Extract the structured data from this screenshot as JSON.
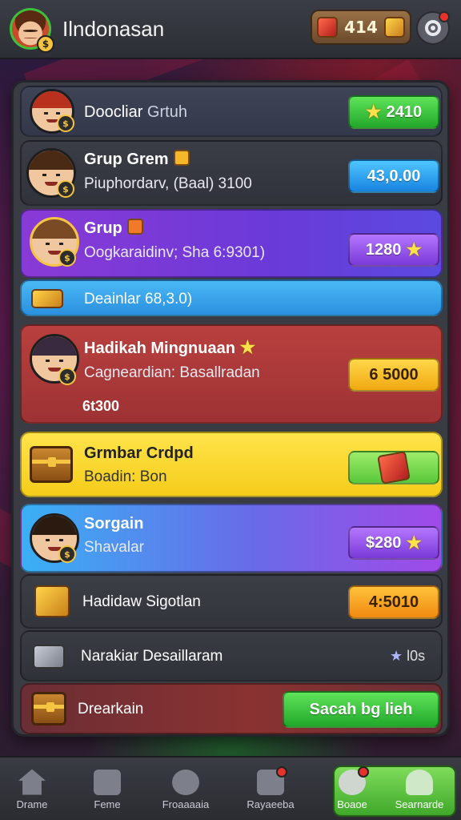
{
  "header": {
    "title": "Ilndonasan",
    "currency_value": "414",
    "gem_icon": "gem-icon",
    "chest_icon": "chest-icon",
    "settings_icon": "settings-icon"
  },
  "items": [
    {
      "title": "Doocliar",
      "subtitle": "Grtuh",
      "button": "2410",
      "button_color": "#3fc83a"
    },
    {
      "title": "Grup Grem",
      "subtitle": "Piuphordarv, (Baal) 3100",
      "button": "43,0.00",
      "button_color": "#2a9aef"
    },
    {
      "title": "Grup",
      "subtitle": "Oogkaraidinv; Sha 6:9301)",
      "button": "1280",
      "button_color": "#9a5aef"
    },
    {
      "title": "",
      "subtitle": "Deainlar 68,3.0)",
      "button": "",
      "button_color": "#3aa8f0"
    },
    {
      "title": "Hadikah Mingnuaan",
      "subtitle": "Cagneardian: Basallradan",
      "extra": "6t300",
      "button": "6 5000",
      "button_color": "#f5c02a"
    },
    {
      "title": "Grmbar Crdpd",
      "subtitle": "Boadin: Bon",
      "button": "",
      "button_color": "#7ad84a"
    },
    {
      "title": "Sorgain",
      "subtitle": "Shavalar",
      "button": "$280",
      "button_color": "#9a5aef"
    },
    {
      "title": "Hadidaw Sigotlan",
      "subtitle": "",
      "button": "4:5010",
      "button_color": "#f5a020"
    },
    {
      "title": "Narakiar Desaillaram",
      "subtitle": "",
      "button": "l0s",
      "button_color": ""
    },
    {
      "title": "Drearkain",
      "subtitle": "",
      "button": "Sacah bg lieh",
      "button_color": "#28c840"
    }
  ],
  "nav": [
    {
      "label": "Drame",
      "icon": "home-icon"
    },
    {
      "label": "Feme",
      "icon": "shop-icon"
    },
    {
      "label": "Froaaaaia",
      "icon": "search-icon"
    },
    {
      "label": "Rayaeeba",
      "icon": "rewards-icon"
    },
    {
      "label": "Boaoe",
      "icon": "badge-icon"
    },
    {
      "label": "Searnarde",
      "icon": "profile-icon"
    }
  ],
  "colors": {
    "accent_green": "#3fc83a",
    "accent_blue": "#2a9aef",
    "accent_purple": "#9a5aef",
    "accent_yellow": "#f5c02a",
    "card_red": "#b03a3a"
  }
}
